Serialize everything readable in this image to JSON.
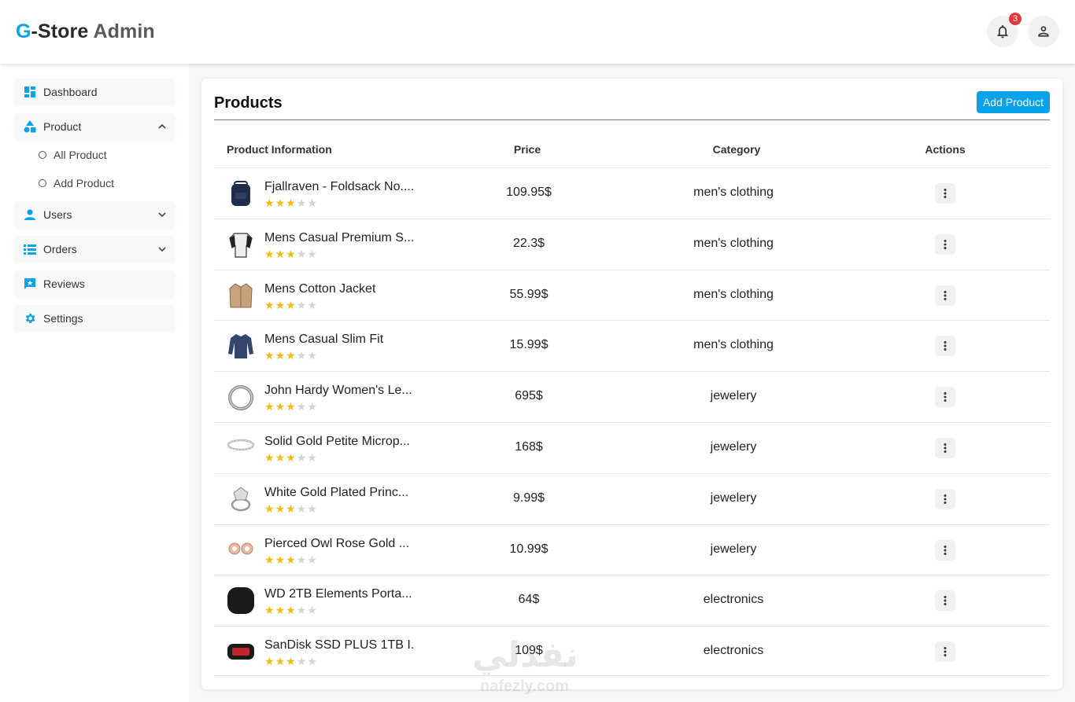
{
  "header": {
    "logo_g": "G",
    "logo_store": "-Store",
    "logo_admin": "Admin",
    "notification_count": "3",
    "bell_icon": "bell-icon",
    "user_icon": "user-icon"
  },
  "sidebar": {
    "items": [
      {
        "label": "Dashboard",
        "icon": "dashboard-icon"
      },
      {
        "label": "Product",
        "icon": "shapes-icon",
        "expanded": true
      },
      {
        "label": "Users",
        "icon": "person-icon"
      },
      {
        "label": "Orders",
        "icon": "list-icon"
      },
      {
        "label": "Reviews",
        "icon": "review-icon"
      },
      {
        "label": "Settings",
        "icon": "gear-icon"
      }
    ],
    "sub_items": [
      {
        "label": "All Product"
      },
      {
        "label": "Add Product"
      }
    ]
  },
  "main": {
    "title": "Products",
    "add_button": "Add Product",
    "columns": [
      "Product Information",
      "Price",
      "Category",
      "Actions"
    ],
    "rows": [
      {
        "name": "Fjallraven - Foldsack No....",
        "price": "109.95$",
        "category": "men's clothing",
        "rating": 3,
        "thumb": "backpack"
      },
      {
        "name": "Mens Casual Premium S...",
        "price": "22.3$",
        "category": "men's clothing",
        "rating": 3,
        "thumb": "shirt"
      },
      {
        "name": "Mens Cotton Jacket",
        "price": "55.99$",
        "category": "men's clothing",
        "rating": 3,
        "thumb": "jacket"
      },
      {
        "name": "Mens Casual Slim Fit",
        "price": "15.99$",
        "category": "men's clothing",
        "rating": 3,
        "thumb": "longsleeve"
      },
      {
        "name": "John Hardy Women's Le...",
        "price": "695$",
        "category": "jewelery",
        "rating": 3,
        "thumb": "bracelet"
      },
      {
        "name": "Solid Gold Petite Microp...",
        "price": "168$",
        "category": "jewelery",
        "rating": 3,
        "thumb": "ring-band"
      },
      {
        "name": "White Gold Plated Princ...",
        "price": "9.99$",
        "category": "jewelery",
        "rating": 3,
        "thumb": "ring"
      },
      {
        "name": "Pierced Owl Rose Gold ...",
        "price": "10.99$",
        "category": "jewelery",
        "rating": 3,
        "thumb": "earrings"
      },
      {
        "name": "WD 2TB Elements Porta...",
        "price": "64$",
        "category": "electronics",
        "rating": 3,
        "thumb": "harddrive"
      },
      {
        "name": "SanDisk SSD PLUS 1TB I...",
        "price": "109$",
        "category": "electronics",
        "rating": 3,
        "thumb": "ssd"
      }
    ]
  },
  "watermark": {
    "arabic": "نفذلي",
    "latin": "nafezly.com"
  },
  "colors": {
    "accent": "#0aa2e8",
    "star": "#f2bd0f",
    "badge": "#e5383b"
  }
}
